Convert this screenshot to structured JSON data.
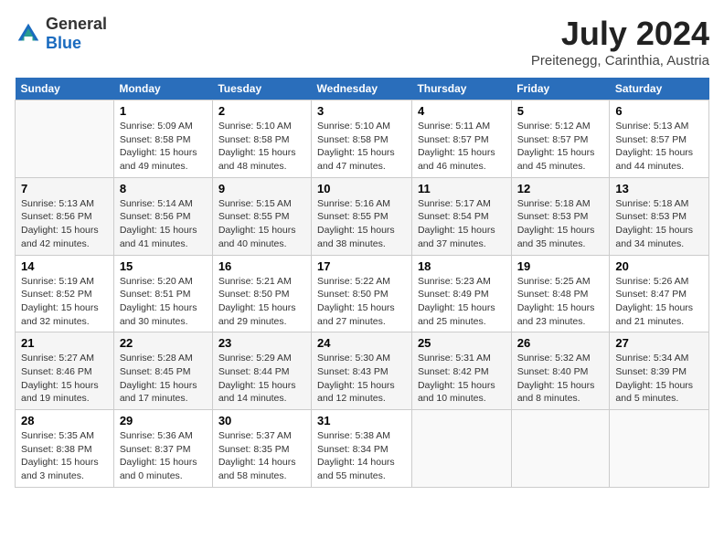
{
  "header": {
    "logo_general": "General",
    "logo_blue": "Blue",
    "month_year": "July 2024",
    "location": "Preitenegg, Carinthia, Austria"
  },
  "weekdays": [
    "Sunday",
    "Monday",
    "Tuesday",
    "Wednesday",
    "Thursday",
    "Friday",
    "Saturday"
  ],
  "weeks": [
    [
      {
        "day": "",
        "info": ""
      },
      {
        "day": "1",
        "info": "Sunrise: 5:09 AM\nSunset: 8:58 PM\nDaylight: 15 hours\nand 49 minutes."
      },
      {
        "day": "2",
        "info": "Sunrise: 5:10 AM\nSunset: 8:58 PM\nDaylight: 15 hours\nand 48 minutes."
      },
      {
        "day": "3",
        "info": "Sunrise: 5:10 AM\nSunset: 8:58 PM\nDaylight: 15 hours\nand 47 minutes."
      },
      {
        "day": "4",
        "info": "Sunrise: 5:11 AM\nSunset: 8:57 PM\nDaylight: 15 hours\nand 46 minutes."
      },
      {
        "day": "5",
        "info": "Sunrise: 5:12 AM\nSunset: 8:57 PM\nDaylight: 15 hours\nand 45 minutes."
      },
      {
        "day": "6",
        "info": "Sunrise: 5:13 AM\nSunset: 8:57 PM\nDaylight: 15 hours\nand 44 minutes."
      }
    ],
    [
      {
        "day": "7",
        "info": "Sunrise: 5:13 AM\nSunset: 8:56 PM\nDaylight: 15 hours\nand 42 minutes."
      },
      {
        "day": "8",
        "info": "Sunrise: 5:14 AM\nSunset: 8:56 PM\nDaylight: 15 hours\nand 41 minutes."
      },
      {
        "day": "9",
        "info": "Sunrise: 5:15 AM\nSunset: 8:55 PM\nDaylight: 15 hours\nand 40 minutes."
      },
      {
        "day": "10",
        "info": "Sunrise: 5:16 AM\nSunset: 8:55 PM\nDaylight: 15 hours\nand 38 minutes."
      },
      {
        "day": "11",
        "info": "Sunrise: 5:17 AM\nSunset: 8:54 PM\nDaylight: 15 hours\nand 37 minutes."
      },
      {
        "day": "12",
        "info": "Sunrise: 5:18 AM\nSunset: 8:53 PM\nDaylight: 15 hours\nand 35 minutes."
      },
      {
        "day": "13",
        "info": "Sunrise: 5:18 AM\nSunset: 8:53 PM\nDaylight: 15 hours\nand 34 minutes."
      }
    ],
    [
      {
        "day": "14",
        "info": "Sunrise: 5:19 AM\nSunset: 8:52 PM\nDaylight: 15 hours\nand 32 minutes."
      },
      {
        "day": "15",
        "info": "Sunrise: 5:20 AM\nSunset: 8:51 PM\nDaylight: 15 hours\nand 30 minutes."
      },
      {
        "day": "16",
        "info": "Sunrise: 5:21 AM\nSunset: 8:50 PM\nDaylight: 15 hours\nand 29 minutes."
      },
      {
        "day": "17",
        "info": "Sunrise: 5:22 AM\nSunset: 8:50 PM\nDaylight: 15 hours\nand 27 minutes."
      },
      {
        "day": "18",
        "info": "Sunrise: 5:23 AM\nSunset: 8:49 PM\nDaylight: 15 hours\nand 25 minutes."
      },
      {
        "day": "19",
        "info": "Sunrise: 5:25 AM\nSunset: 8:48 PM\nDaylight: 15 hours\nand 23 minutes."
      },
      {
        "day": "20",
        "info": "Sunrise: 5:26 AM\nSunset: 8:47 PM\nDaylight: 15 hours\nand 21 minutes."
      }
    ],
    [
      {
        "day": "21",
        "info": "Sunrise: 5:27 AM\nSunset: 8:46 PM\nDaylight: 15 hours\nand 19 minutes."
      },
      {
        "day": "22",
        "info": "Sunrise: 5:28 AM\nSunset: 8:45 PM\nDaylight: 15 hours\nand 17 minutes."
      },
      {
        "day": "23",
        "info": "Sunrise: 5:29 AM\nSunset: 8:44 PM\nDaylight: 15 hours\nand 14 minutes."
      },
      {
        "day": "24",
        "info": "Sunrise: 5:30 AM\nSunset: 8:43 PM\nDaylight: 15 hours\nand 12 minutes."
      },
      {
        "day": "25",
        "info": "Sunrise: 5:31 AM\nSunset: 8:42 PM\nDaylight: 15 hours\nand 10 minutes."
      },
      {
        "day": "26",
        "info": "Sunrise: 5:32 AM\nSunset: 8:40 PM\nDaylight: 15 hours\nand 8 minutes."
      },
      {
        "day": "27",
        "info": "Sunrise: 5:34 AM\nSunset: 8:39 PM\nDaylight: 15 hours\nand 5 minutes."
      }
    ],
    [
      {
        "day": "28",
        "info": "Sunrise: 5:35 AM\nSunset: 8:38 PM\nDaylight: 15 hours\nand 3 minutes."
      },
      {
        "day": "29",
        "info": "Sunrise: 5:36 AM\nSunset: 8:37 PM\nDaylight: 15 hours\nand 0 minutes."
      },
      {
        "day": "30",
        "info": "Sunrise: 5:37 AM\nSunset: 8:35 PM\nDaylight: 14 hours\nand 58 minutes."
      },
      {
        "day": "31",
        "info": "Sunrise: 5:38 AM\nSunset: 8:34 PM\nDaylight: 14 hours\nand 55 minutes."
      },
      {
        "day": "",
        "info": ""
      },
      {
        "day": "",
        "info": ""
      },
      {
        "day": "",
        "info": ""
      }
    ]
  ]
}
